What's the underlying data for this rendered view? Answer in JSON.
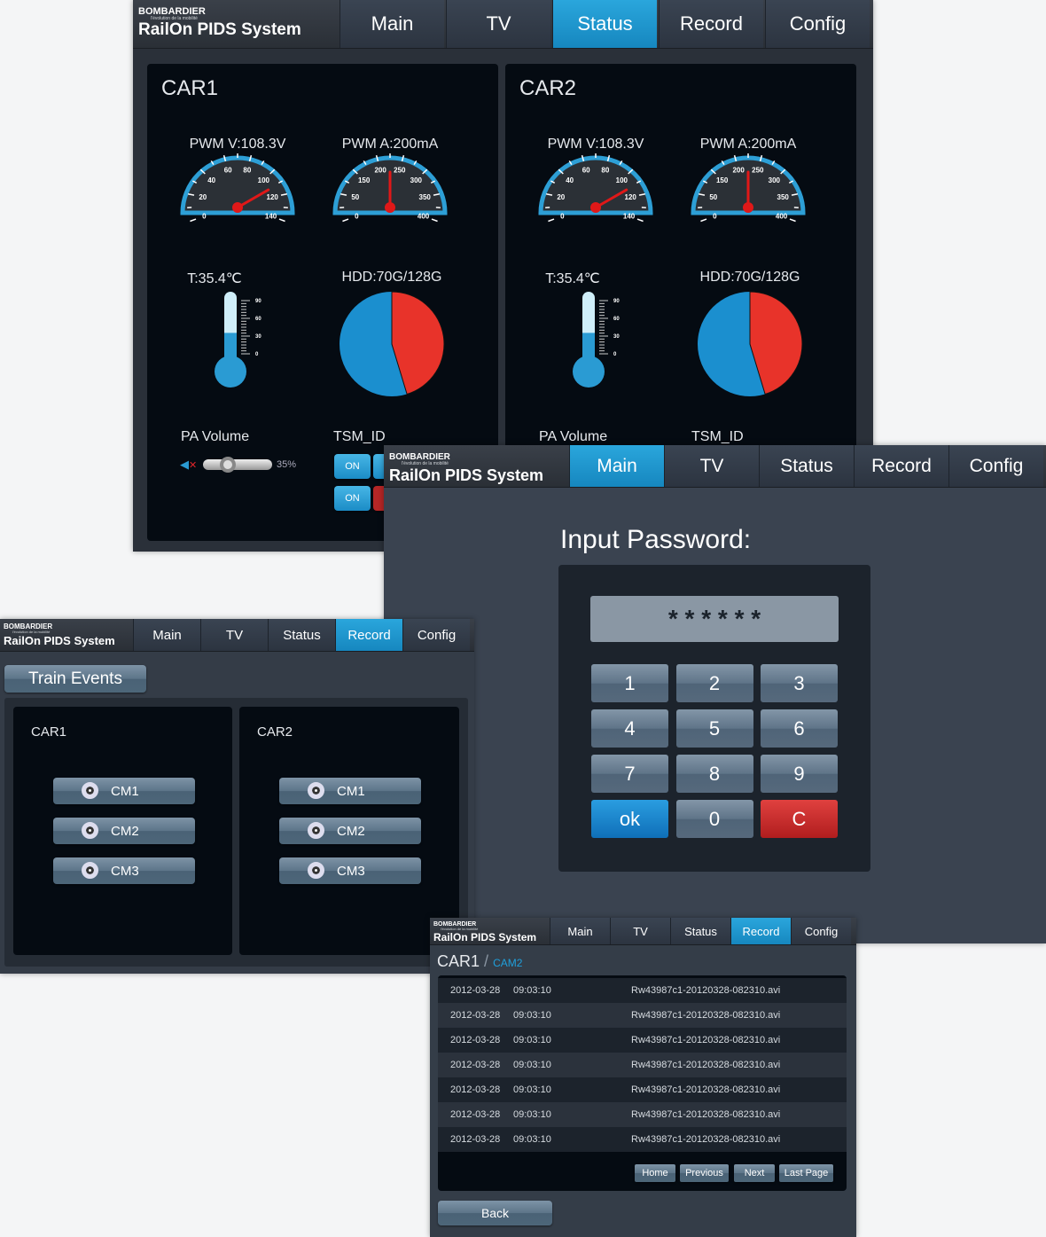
{
  "brand": {
    "company": "BOMBARDIER",
    "tagline": "l'évolution de la mobilité",
    "system": "RailOn PIDS System"
  },
  "nav": [
    "Main",
    "TV",
    "Status",
    "Record",
    "Config"
  ],
  "colors": {
    "accent": "#1a9ad6",
    "panel": "#050b12",
    "window": "#343c47",
    "danger": "#c8282a",
    "pie_free": "#e8332a",
    "pie_used": "#1b8fcf"
  },
  "status_window": {
    "active_tab": "Status",
    "cars": [
      {
        "title": "CAR1",
        "pwm_v": "PWM V:108.3V",
        "pwm_v_value": 108.3,
        "pwm_v_ticks": [
          "0",
          "20",
          "40",
          "60",
          "80",
          "100",
          "120",
          "140"
        ],
        "pwm_a": "PWM A:200mA",
        "pwm_a_value": 200,
        "pwm_a_ticks": [
          "0",
          "50",
          "150",
          "200",
          "250",
          "300",
          "350",
          "400"
        ],
        "temp": "T:35.4℃",
        "temp_value": 35.4,
        "temp_ticks": [
          "0",
          "30",
          "60",
          "90"
        ],
        "hdd": "HDD:70G/128G",
        "hdd_used": 70,
        "hdd_total": 128,
        "pa_volume": "PA Volume",
        "volume_value": "35%",
        "volume": 35,
        "tsm": "TSM_ID",
        "tsm_buttons": [
          "ON",
          "ON"
        ]
      },
      {
        "title": "CAR2",
        "pwm_v": "PWM V:108.3V",
        "pwm_v_value": 108.3,
        "pwm_v_ticks": [
          "0",
          "20",
          "40",
          "60",
          "80",
          "100",
          "120",
          "140"
        ],
        "pwm_a": "PWM A:200mA",
        "pwm_a_value": 200,
        "pwm_a_ticks": [
          "0",
          "50",
          "150",
          "200",
          "250",
          "300",
          "350",
          "400"
        ],
        "temp": "T:35.4℃",
        "temp_value": 35.4,
        "temp_ticks": [
          "0",
          "30",
          "60",
          "90"
        ],
        "hdd": "HDD:70G/128G",
        "hdd_used": 70,
        "hdd_total": 128,
        "pa_volume": "PA Volume",
        "tsm": "TSM_ID"
      }
    ]
  },
  "password_window": {
    "active_tab": "Main",
    "title": "Input Password:",
    "masked_value": "* * * * * *",
    "keys": [
      "1",
      "2",
      "3",
      "4",
      "5",
      "6",
      "7",
      "8",
      "9",
      "ok",
      "0",
      "C"
    ]
  },
  "events_window": {
    "active_tab": "Record",
    "button": "Train Events",
    "cars": [
      {
        "title": "CAR1",
        "cams": [
          "CM1",
          "CM2",
          "CM3"
        ]
      },
      {
        "title": "CAR2",
        "cams": [
          "CM1",
          "CM2",
          "CM3"
        ]
      }
    ]
  },
  "record_window": {
    "active_tab": "Record",
    "car": "CAR1",
    "separator": "/",
    "cam": "CAM2",
    "rows": [
      {
        "date": "2012-03-28",
        "time": "09:03:10",
        "file": "Rw43987c1-20120328-082310.avi"
      },
      {
        "date": "2012-03-28",
        "time": "09:03:10",
        "file": "Rw43987c1-20120328-082310.avi"
      },
      {
        "date": "2012-03-28",
        "time": "09:03:10",
        "file": "Rw43987c1-20120328-082310.avi"
      },
      {
        "date": "2012-03-28",
        "time": "09:03:10",
        "file": "Rw43987c1-20120328-082310.avi"
      },
      {
        "date": "2012-03-28",
        "time": "09:03:10",
        "file": "Rw43987c1-20120328-082310.avi"
      },
      {
        "date": "2012-03-28",
        "time": "09:03:10",
        "file": "Rw43987c1-20120328-082310.avi"
      },
      {
        "date": "2012-03-28",
        "time": "09:03:10",
        "file": "Rw43987c1-20120328-082310.avi"
      }
    ],
    "pager": [
      "Home",
      "Previous",
      "Next",
      "Last Page"
    ],
    "back": "Back"
  }
}
